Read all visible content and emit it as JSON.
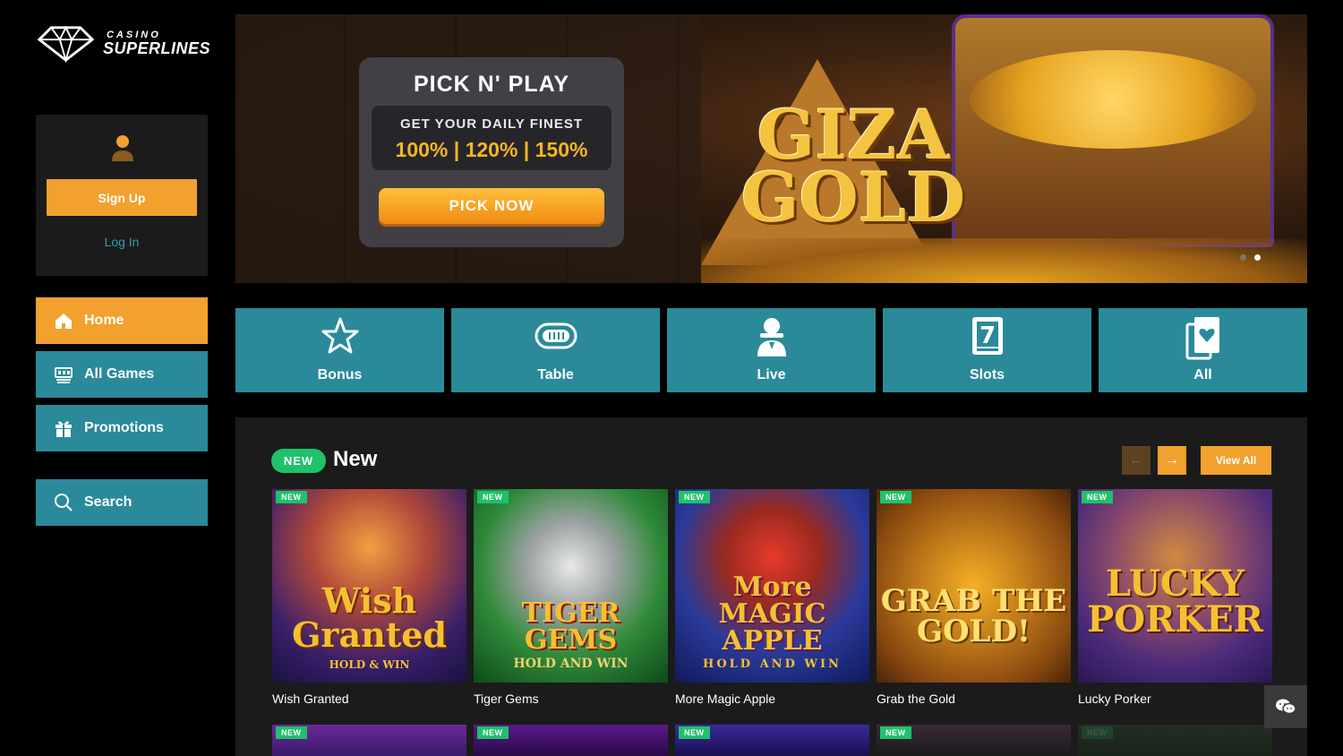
{
  "brand": {
    "small": "CASINO",
    "big": "SUPERLINES"
  },
  "auth": {
    "signup_label": "Sign Up",
    "login_label": "Log In"
  },
  "nav": {
    "home": "Home",
    "all_games": "All Games",
    "promotions": "Promotions",
    "search": "Search"
  },
  "banner": {
    "promo_title": "PICK N' PLAY",
    "promo_subtitle": "GET YOUR DAILY FINEST",
    "promo_percentages": "100% | 120% | 150%",
    "promo_button": "PICK NOW",
    "game_logo_line1": "GIZA",
    "game_logo_line2": "GOLD",
    "slide_count": 2,
    "active_slide": 2
  },
  "categories": [
    {
      "label": "Bonus",
      "icon": "star-icon"
    },
    {
      "label": "Table",
      "icon": "chip-icon"
    },
    {
      "label": "Live",
      "icon": "dealer-icon"
    },
    {
      "label": "Slots",
      "icon": "slot-seven-icon"
    },
    {
      "label": "All",
      "icon": "cards-heart-icon"
    }
  ],
  "games_section": {
    "badge": "NEW",
    "title": "New",
    "view_all": "View All",
    "tag": "NEW",
    "games": [
      {
        "name": "Wish Granted",
        "art": "Wish Granted",
        "art_sub": "HOLD & WIN"
      },
      {
        "name": "Tiger Gems",
        "art": "TIGER GEMS",
        "art_sub": "HOLD AND WIN"
      },
      {
        "name": "More Magic Apple",
        "art": "More MAGIC APPLE",
        "art_sub": "HOLD AND WIN"
      },
      {
        "name": "Grab the Gold",
        "art": "GRAB THE GOLD!",
        "art_sub": ""
      },
      {
        "name": "Lucky Porker",
        "art": "LUCKY PORKER",
        "art_sub": ""
      }
    ]
  },
  "colors": {
    "accent_orange": "#f2a12e",
    "teal": "#2a8a99",
    "new_green": "#1fc16b",
    "panel": "#1b1b1b"
  }
}
